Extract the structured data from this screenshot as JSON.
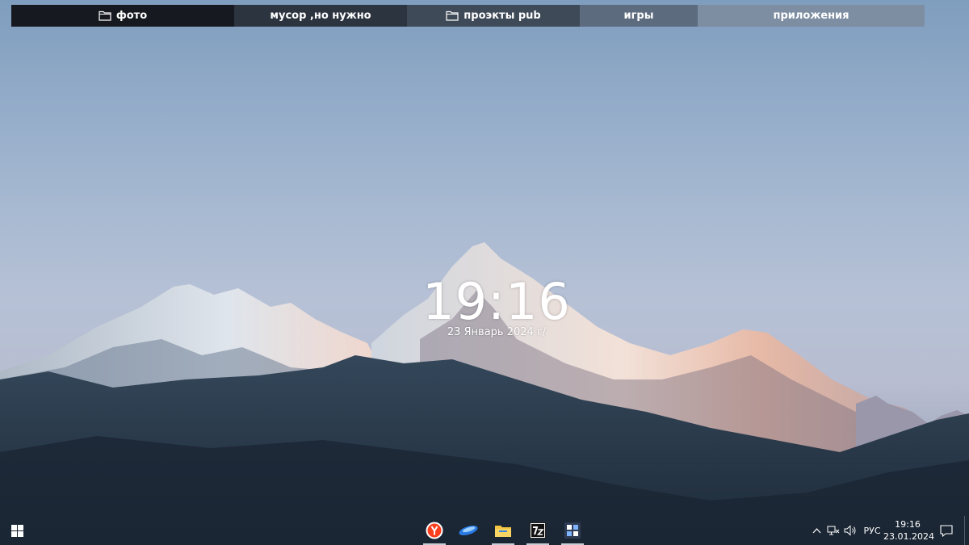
{
  "fences": [
    {
      "label": "фото",
      "folder_icon": true,
      "bg": "#16191f",
      "width": 276
    },
    {
      "label": "мусор ,но нужно",
      "folder_icon": false,
      "bg": "#2c3440",
      "width": 214
    },
    {
      "label": "проэкты pub",
      "folder_icon": true,
      "bg": "#3f4a58",
      "width": 214
    },
    {
      "label": "игры",
      "folder_icon": false,
      "bg": "#5c6b7d",
      "width": 146
    },
    {
      "label": "приложения",
      "folder_icon": false,
      "bg": "#7d8ea2",
      "width": 281
    }
  ],
  "clock_widget": {
    "time": "19:16",
    "date": "23 Январь 2024 г/"
  },
  "taskbar": {
    "pinned_apps": [
      {
        "name": "yandex-browser-icon"
      },
      {
        "name": "pinned-app-2-icon"
      },
      {
        "name": "file-explorer-icon"
      },
      {
        "name": "7zip-icon"
      },
      {
        "name": "widgets-app-icon"
      }
    ],
    "tray": {
      "language": "РУС",
      "time": "19:16",
      "date": "23.01.2024"
    }
  },
  "colors": {
    "accent_yandex": "#fc3f1d",
    "folder_yellow": "#f4c542"
  }
}
